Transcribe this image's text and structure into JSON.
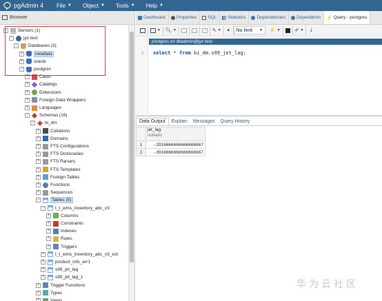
{
  "app": {
    "title": "pgAdmin 4"
  },
  "menu": [
    {
      "label": "File"
    },
    {
      "label": "Object"
    },
    {
      "label": "Tools"
    },
    {
      "label": "Help"
    }
  ],
  "browser": {
    "title": "Browser",
    "tree": [
      {
        "label": "Servers (1)",
        "icon": "server-icon",
        "expander": "⊟",
        "name": "tree-servers"
      },
      {
        "label": "jyz-test",
        "icon": "postgres-server-icon",
        "expander": "⊟",
        "name": "tree-server-jyz-test"
      },
      {
        "label": "Databases (3)",
        "icon": "databases-icon",
        "expander": "⊟",
        "name": "tree-databases"
      },
      {
        "label": "newdata",
        "icon": "database-icon",
        "expander": "⊞",
        "name": "tree-db-newdata"
      },
      {
        "label": "oracle",
        "icon": "database-icon",
        "expander": "⊞",
        "name": "tree-db-oracle"
      },
      {
        "label": "postgres",
        "icon": "database-icon",
        "expander": "⊟",
        "name": "tree-db-postgres"
      },
      {
        "label": "Casts",
        "icon": "casts-icon",
        "expander": "⊞",
        "name": "tree-casts"
      },
      {
        "label": "Catalogs",
        "icon": "catalogs-icon",
        "expander": "⊞",
        "name": "tree-catalogs"
      },
      {
        "label": "Extensions",
        "icon": "extensions-icon",
        "expander": "⊞",
        "name": "tree-extensions"
      },
      {
        "label": "Foreign Data Wrappers",
        "icon": "fdw-icon",
        "expander": "⊞",
        "name": "tree-fdw"
      },
      {
        "label": "Languages",
        "icon": "languages-icon",
        "expander": "⊞",
        "name": "tree-languages"
      },
      {
        "label": "Schemas (16)",
        "icon": "schemas-icon",
        "expander": "⊟",
        "name": "tree-schemas"
      },
      {
        "label": "bi_dm",
        "icon": "schema-icon",
        "expander": "⊟",
        "name": "tree-schema-bi-dm"
      },
      {
        "label": "Collations",
        "icon": "collations-icon",
        "expander": "⊞",
        "name": "tree-collations"
      },
      {
        "label": "Domains",
        "icon": "domains-icon",
        "expander": "⊞",
        "name": "tree-domains"
      },
      {
        "label": "FTS Configurations",
        "icon": "fts-config-icon",
        "expander": "⊞",
        "name": "tree-fts-configurations"
      },
      {
        "label": "FTS Dictionaries",
        "icon": "fts-dict-icon",
        "expander": "⊞",
        "name": "tree-fts-dictionaries"
      },
      {
        "label": "FTS Parsers",
        "icon": "fts-parser-icon",
        "expander": "⊞",
        "name": "tree-fts-parsers"
      },
      {
        "label": "FTS Templates",
        "icon": "fts-template-icon",
        "expander": "⊞",
        "name": "tree-fts-templates"
      },
      {
        "label": "Foreign Tables",
        "icon": "foreign-table-icon",
        "expander": "⊞",
        "name": "tree-foreign-tables"
      },
      {
        "label": "Functions",
        "icon": "functions-icon",
        "expander": "⊞",
        "name": "tree-functions"
      },
      {
        "label": "Sequences",
        "icon": "sequences-icon",
        "expander": "⊞",
        "name": "tree-sequences"
      },
      {
        "label": "Tables (5)",
        "icon": "tables-icon",
        "expander": "⊟",
        "name": "tree-tables"
      },
      {
        "label": "t_t_wms_inventory_abc_v3",
        "icon": "table-icon",
        "expander": "⊟",
        "name": "tree-table-inventory-v3"
      },
      {
        "label": "Columns",
        "icon": "columns-icon",
        "expander": "⊞",
        "name": "tree-columns"
      },
      {
        "label": "Constraints",
        "icon": "constraints-icon",
        "expander": "⊞",
        "name": "tree-constraints"
      },
      {
        "label": "Indexes",
        "icon": "indexes-icon",
        "expander": "⊞",
        "name": "tree-indexes"
      },
      {
        "label": "Rules",
        "icon": "rules-icon",
        "expander": "⊞",
        "name": "tree-rules"
      },
      {
        "label": "Triggers",
        "icon": "triggers-icon",
        "expander": "⊞",
        "name": "tree-triggers"
      },
      {
        "label": "t_t_wms_inventory_abc_v3_ext",
        "icon": "table-icon",
        "expander": "⊞",
        "name": "tree-table-inventory-v3-ext"
      },
      {
        "label": "product_info_err1",
        "icon": "table-icon",
        "expander": "⊞",
        "name": "tree-table-product-info-err1"
      },
      {
        "label": "s99_jet_lag",
        "icon": "table-icon",
        "expander": "⊞",
        "name": "tree-table-s99-jet-lag"
      },
      {
        "label": "s99_jet_lag_1",
        "icon": "table-icon",
        "expander": "⊞",
        "name": "tree-table-s99-jet-lag-1"
      },
      {
        "label": "Trigger Functions",
        "icon": "trigger-functions-icon",
        "expander": "⊞",
        "name": "tree-trigger-functions"
      },
      {
        "label": "Types",
        "icon": "types-icon",
        "expander": "⊞",
        "name": "tree-types"
      },
      {
        "label": "Views",
        "icon": "views-icon",
        "expander": "⊞",
        "name": "tree-views"
      }
    ]
  },
  "tabs": [
    {
      "label": "Dashboard",
      "icon": "dashboard-icon"
    },
    {
      "label": "Properties",
      "icon": "properties-icon"
    },
    {
      "label": "SQL",
      "icon": "sql-icon"
    },
    {
      "label": "Statistics",
      "icon": "statistics-icon"
    },
    {
      "label": "Dependencies",
      "icon": "dependencies-icon"
    },
    {
      "label": "Dependents",
      "icon": "dependents-icon"
    },
    {
      "label": "Query - postgres",
      "icon": "lightning-icon"
    }
  ],
  "toolbar": {
    "limit_label": "No limit"
  },
  "query": {
    "connection": "postgres on dbadmin@jyz-test",
    "line_number": "1",
    "kw_select": "select",
    "star": " * ",
    "kw_from": "from",
    "rest": " bi_dm.s99_jet_lag;"
  },
  "results": {
    "tabs": [
      "Data Output",
      "Explain",
      "Messages",
      "Query History"
    ],
    "column": {
      "name": "jet_lag",
      "type": "numeric"
    },
    "rows": [
      {
        "n": "1",
        "value": "-.2916666666666666667"
      },
      {
        "n": "2",
        "value": "-.3916666666666666667"
      }
    ]
  },
  "watermark": "华为云社区",
  "colors": {
    "menubar": "#326690",
    "highlight_box": "#dd3333"
  }
}
